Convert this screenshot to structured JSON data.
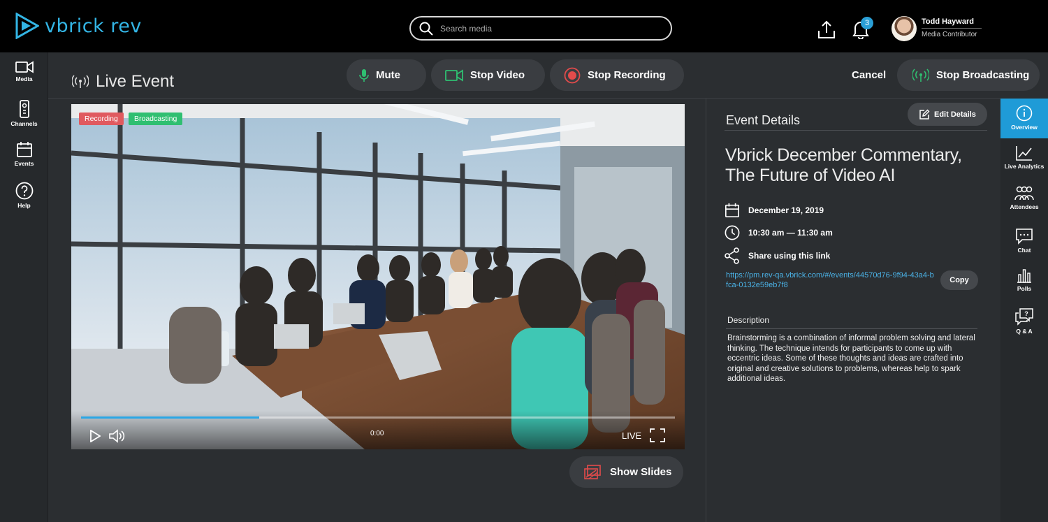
{
  "app": {
    "brand": "vbrick rev",
    "brand_color": "#33b5e5"
  },
  "search": {
    "placeholder": "Search media"
  },
  "notifications": {
    "count": "3"
  },
  "user": {
    "name": "Todd Hayward",
    "role": "Media Contributor"
  },
  "left_nav": [
    {
      "label": "Media",
      "icon": "video-camera-icon"
    },
    {
      "label": "Channels",
      "icon": "remote-icon"
    },
    {
      "label": "Events",
      "icon": "calendar-icon"
    },
    {
      "label": "Help",
      "icon": "help-icon"
    }
  ],
  "header": {
    "title": "Live Event",
    "mute_label": "Mute",
    "stop_video_label": "Stop Video",
    "stop_recording_label": "Stop Recording",
    "cancel_label": "Cancel",
    "stop_broadcasting_label": "Stop Broadcasting",
    "accent_green": "#2fbf71",
    "accent_red": "#e34b4b"
  },
  "video": {
    "tags": {
      "recording": "Recording",
      "broadcasting": "Broadcasting"
    },
    "time": "0:00",
    "live_label": "LIVE",
    "progress": 0.3
  },
  "show_slides_label": "Show Slides",
  "details": {
    "title": "Event Details",
    "edit_label": "Edit Details",
    "event_name": "Vbrick December Commentary, The Future of Video AI",
    "date": "December 19, 2019",
    "time": "10:30 am — 11:30 am",
    "share_label": "Share using this link",
    "share_url": "https://pm.rev-qa.vbrick.com/#/events/44570d76-9f94-43a4-bfca-0132e59eb7f8",
    "copy_label": "Copy",
    "description_label": "Description",
    "description": "Brainstorming is a combination of informal problem solving and lateral thinking. The technique intends for participants to come up with eccentric ideas. Some of these thoughts and ideas are crafted into original and creative solutions to problems, whereas help to spark additional ideas."
  },
  "right_rail": [
    {
      "label": "Overview",
      "icon": "info-icon",
      "active": true
    },
    {
      "label": "Live Analytics",
      "icon": "line-chart-icon"
    },
    {
      "label": "Attendees",
      "icon": "people-icon"
    },
    {
      "label": "Chat",
      "icon": "chat-bubble-icon"
    },
    {
      "label": "Polls",
      "icon": "bar-chart-icon"
    },
    {
      "label": "Q & A",
      "icon": "question-bubble-icon"
    }
  ]
}
